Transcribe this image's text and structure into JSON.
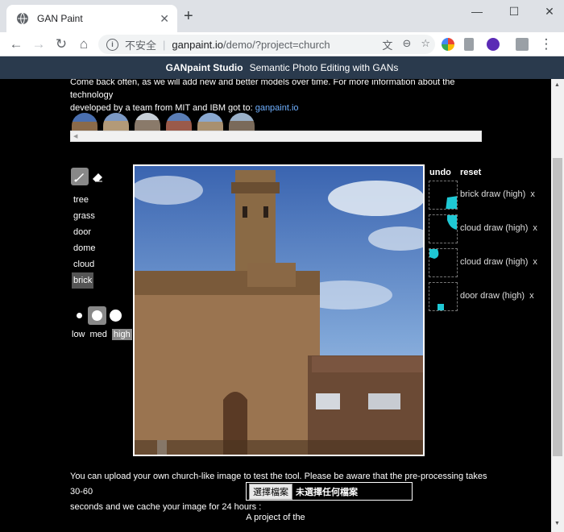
{
  "browser": {
    "tab_title": "GAN Paint",
    "new_tab": "+",
    "tab_close": "✕",
    "win_min": "—",
    "win_max": "☐",
    "win_close": "✕",
    "security_label": "不安全",
    "url_host": "ganpaint.io",
    "url_path": "/demo/?project=church"
  },
  "banner": {
    "brand": "GANpaint Studio",
    "tagline": "Semantic Photo Editing with GANs"
  },
  "intro": {
    "line1": "Come back often, as we will add new and better models over time. For more information about the technology",
    "line2": "developed by a team from MIT and IBM got to: ",
    "link": "ganpaint.io"
  },
  "labels": {
    "items": [
      "tree",
      "grass",
      "door",
      "dome",
      "cloud",
      "brick"
    ],
    "active": "brick"
  },
  "brush_sizes": {
    "low": "low",
    "med": "med",
    "high": "high",
    "selected": "high"
  },
  "history": {
    "undo": "undo",
    "reset": "reset",
    "entries": [
      {
        "label": "brick draw (high)",
        "close": "x"
      },
      {
        "label": "cloud draw (high)",
        "close": "x"
      },
      {
        "label": "cloud draw (high)",
        "close": "x"
      },
      {
        "label": "door draw (high)",
        "close": "x"
      }
    ]
  },
  "upload": {
    "text1": "You can upload your own church-like image to test the tool. Please be aware that the pre-processing takes 30-60",
    "text2": "seconds and we cache your image for 24 hours :",
    "button": "選擇檔案",
    "no_file": "未選擇任何檔案"
  },
  "footer": {
    "text": "A project of the"
  },
  "colors": {
    "accent": "#1fc8d4",
    "banner": "#2a3a4d",
    "link": "#6fb0ff"
  }
}
